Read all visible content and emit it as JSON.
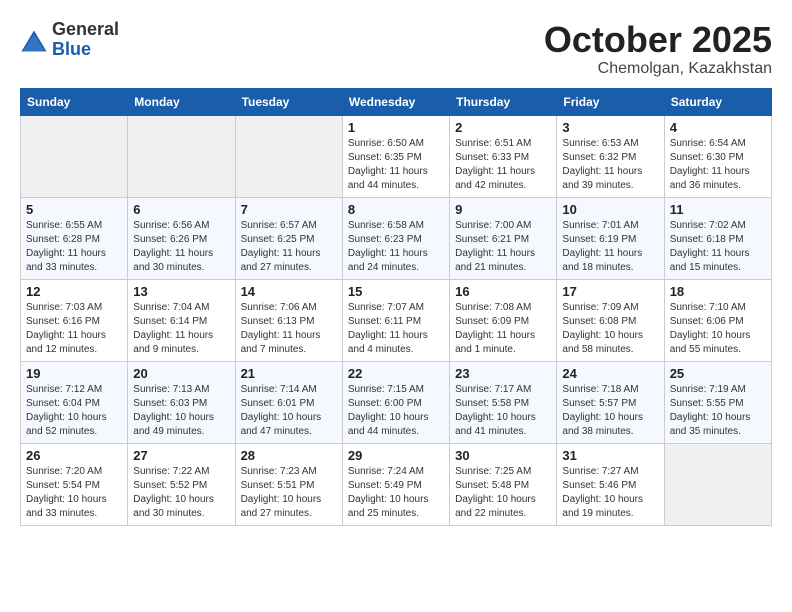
{
  "logo": {
    "general": "General",
    "blue": "Blue"
  },
  "title": "October 2025",
  "subtitle": "Chemolgan, Kazakhstan",
  "days_of_week": [
    "Sunday",
    "Monday",
    "Tuesday",
    "Wednesday",
    "Thursday",
    "Friday",
    "Saturday"
  ],
  "weeks": [
    [
      {
        "num": "",
        "info": ""
      },
      {
        "num": "",
        "info": ""
      },
      {
        "num": "",
        "info": ""
      },
      {
        "num": "1",
        "info": "Sunrise: 6:50 AM\nSunset: 6:35 PM\nDaylight: 11 hours\nand 44 minutes."
      },
      {
        "num": "2",
        "info": "Sunrise: 6:51 AM\nSunset: 6:33 PM\nDaylight: 11 hours\nand 42 minutes."
      },
      {
        "num": "3",
        "info": "Sunrise: 6:53 AM\nSunset: 6:32 PM\nDaylight: 11 hours\nand 39 minutes."
      },
      {
        "num": "4",
        "info": "Sunrise: 6:54 AM\nSunset: 6:30 PM\nDaylight: 11 hours\nand 36 minutes."
      }
    ],
    [
      {
        "num": "5",
        "info": "Sunrise: 6:55 AM\nSunset: 6:28 PM\nDaylight: 11 hours\nand 33 minutes."
      },
      {
        "num": "6",
        "info": "Sunrise: 6:56 AM\nSunset: 6:26 PM\nDaylight: 11 hours\nand 30 minutes."
      },
      {
        "num": "7",
        "info": "Sunrise: 6:57 AM\nSunset: 6:25 PM\nDaylight: 11 hours\nand 27 minutes."
      },
      {
        "num": "8",
        "info": "Sunrise: 6:58 AM\nSunset: 6:23 PM\nDaylight: 11 hours\nand 24 minutes."
      },
      {
        "num": "9",
        "info": "Sunrise: 7:00 AM\nSunset: 6:21 PM\nDaylight: 11 hours\nand 21 minutes."
      },
      {
        "num": "10",
        "info": "Sunrise: 7:01 AM\nSunset: 6:19 PM\nDaylight: 11 hours\nand 18 minutes."
      },
      {
        "num": "11",
        "info": "Sunrise: 7:02 AM\nSunset: 6:18 PM\nDaylight: 11 hours\nand 15 minutes."
      }
    ],
    [
      {
        "num": "12",
        "info": "Sunrise: 7:03 AM\nSunset: 6:16 PM\nDaylight: 11 hours\nand 12 minutes."
      },
      {
        "num": "13",
        "info": "Sunrise: 7:04 AM\nSunset: 6:14 PM\nDaylight: 11 hours\nand 9 minutes."
      },
      {
        "num": "14",
        "info": "Sunrise: 7:06 AM\nSunset: 6:13 PM\nDaylight: 11 hours\nand 7 minutes."
      },
      {
        "num": "15",
        "info": "Sunrise: 7:07 AM\nSunset: 6:11 PM\nDaylight: 11 hours\nand 4 minutes."
      },
      {
        "num": "16",
        "info": "Sunrise: 7:08 AM\nSunset: 6:09 PM\nDaylight: 11 hours\nand 1 minute."
      },
      {
        "num": "17",
        "info": "Sunrise: 7:09 AM\nSunset: 6:08 PM\nDaylight: 10 hours\nand 58 minutes."
      },
      {
        "num": "18",
        "info": "Sunrise: 7:10 AM\nSunset: 6:06 PM\nDaylight: 10 hours\nand 55 minutes."
      }
    ],
    [
      {
        "num": "19",
        "info": "Sunrise: 7:12 AM\nSunset: 6:04 PM\nDaylight: 10 hours\nand 52 minutes."
      },
      {
        "num": "20",
        "info": "Sunrise: 7:13 AM\nSunset: 6:03 PM\nDaylight: 10 hours\nand 49 minutes."
      },
      {
        "num": "21",
        "info": "Sunrise: 7:14 AM\nSunset: 6:01 PM\nDaylight: 10 hours\nand 47 minutes."
      },
      {
        "num": "22",
        "info": "Sunrise: 7:15 AM\nSunset: 6:00 PM\nDaylight: 10 hours\nand 44 minutes."
      },
      {
        "num": "23",
        "info": "Sunrise: 7:17 AM\nSunset: 5:58 PM\nDaylight: 10 hours\nand 41 minutes."
      },
      {
        "num": "24",
        "info": "Sunrise: 7:18 AM\nSunset: 5:57 PM\nDaylight: 10 hours\nand 38 minutes."
      },
      {
        "num": "25",
        "info": "Sunrise: 7:19 AM\nSunset: 5:55 PM\nDaylight: 10 hours\nand 35 minutes."
      }
    ],
    [
      {
        "num": "26",
        "info": "Sunrise: 7:20 AM\nSunset: 5:54 PM\nDaylight: 10 hours\nand 33 minutes."
      },
      {
        "num": "27",
        "info": "Sunrise: 7:22 AM\nSunset: 5:52 PM\nDaylight: 10 hours\nand 30 minutes."
      },
      {
        "num": "28",
        "info": "Sunrise: 7:23 AM\nSunset: 5:51 PM\nDaylight: 10 hours\nand 27 minutes."
      },
      {
        "num": "29",
        "info": "Sunrise: 7:24 AM\nSunset: 5:49 PM\nDaylight: 10 hours\nand 25 minutes."
      },
      {
        "num": "30",
        "info": "Sunrise: 7:25 AM\nSunset: 5:48 PM\nDaylight: 10 hours\nand 22 minutes."
      },
      {
        "num": "31",
        "info": "Sunrise: 7:27 AM\nSunset: 5:46 PM\nDaylight: 10 hours\nand 19 minutes."
      },
      {
        "num": "",
        "info": ""
      }
    ]
  ]
}
